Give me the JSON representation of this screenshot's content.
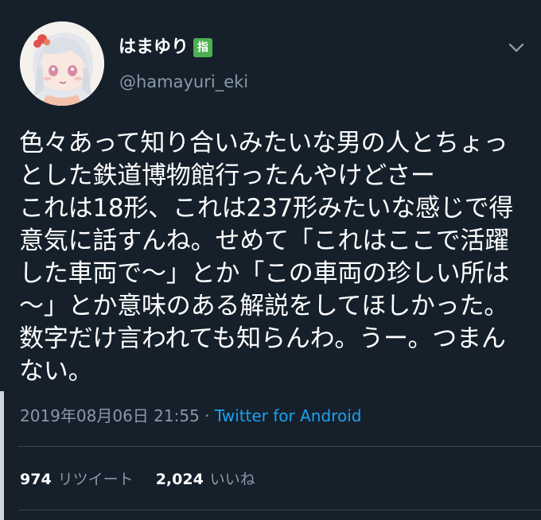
{
  "user": {
    "display_name": "はまゆり",
    "badge": "指",
    "username": "@hamayuri_eki",
    "avatar_icon": "anime-girl-avatar-icon"
  },
  "tweet": {
    "text": "色々あって知り合いみたいな男の人とちょっ\nとした鉄道博物館行ったんやけどさー\nこれは18形、これは237形みたいな感じで得\n意気に話すんね。せめて「これはここで活躍\nした車両で～」とか「この車両の珍しい所は\n～」とか意味のある解説をしてほしかった。\n数字だけ言われても知らんわ。うー。つまん\nない。",
    "timestamp": "2019年08月06日 21:55",
    "separator": " · ",
    "source": "Twitter for Android"
  },
  "stats": {
    "retweets": "974",
    "retweets_label": "リツイート",
    "likes": "2,024",
    "likes_label": "いいね"
  },
  "colors": {
    "background": "#15202b",
    "text": "#ffffff",
    "secondary": "#8899a6",
    "link": "#1da1f2",
    "divider": "#38444d",
    "badge": "#4caf50"
  }
}
